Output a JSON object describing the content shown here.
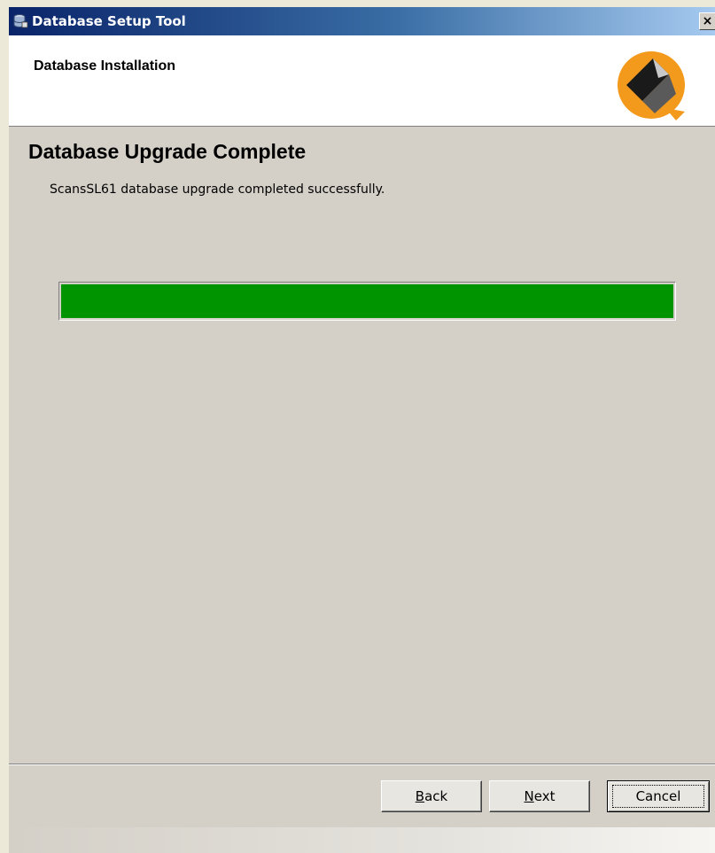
{
  "window": {
    "title": "Database Setup Tool",
    "close_label": "×"
  },
  "header": {
    "title": "Database Installation"
  },
  "main": {
    "heading": "Database Upgrade Complete",
    "status": "ScansSL61 database upgrade completed successfully.",
    "progress_percent": 100,
    "progress_color": "#009500"
  },
  "buttons": {
    "back_mnemonic": "B",
    "back_rest": "ack",
    "next_mnemonic": "N",
    "next_rest": "ext",
    "cancel": "Cancel"
  },
  "icons": {
    "app": "database-icon",
    "logo": "orange-logo-icon",
    "close": "close-icon"
  }
}
